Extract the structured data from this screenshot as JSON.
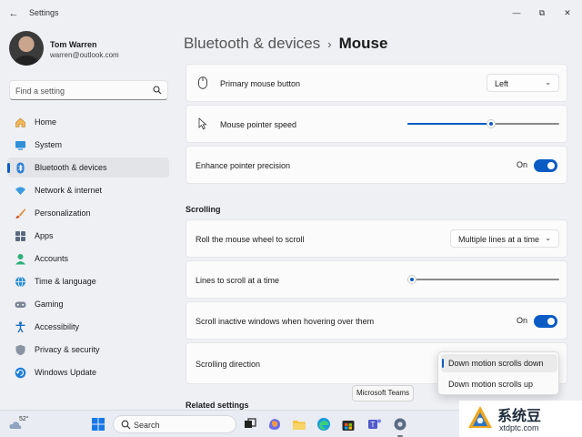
{
  "window": {
    "title": "Settings",
    "back_glyph": "←",
    "minimize_glyph": "—",
    "maximize_glyph": "⧉",
    "close_glyph": "✕"
  },
  "user": {
    "name": "Tom Warren",
    "email": "warren@outlook.com"
  },
  "search": {
    "placeholder": "Find a setting",
    "icon": "search-icon"
  },
  "sidebar": {
    "items": [
      {
        "label": "Home",
        "icon": "home-icon",
        "active": false
      },
      {
        "label": "System",
        "icon": "system-icon",
        "active": false
      },
      {
        "label": "Bluetooth & devices",
        "icon": "bluetooth-icon",
        "active": true
      },
      {
        "label": "Network & internet",
        "icon": "wifi-icon",
        "active": false
      },
      {
        "label": "Personalization",
        "icon": "brush-icon",
        "active": false
      },
      {
        "label": "Apps",
        "icon": "apps-icon",
        "active": false
      },
      {
        "label": "Accounts",
        "icon": "accounts-icon",
        "active": false
      },
      {
        "label": "Time & language",
        "icon": "globe-icon",
        "active": false
      },
      {
        "label": "Gaming",
        "icon": "gamepad-icon",
        "active": false
      },
      {
        "label": "Accessibility",
        "icon": "accessibility-icon",
        "active": false
      },
      {
        "label": "Privacy & security",
        "icon": "shield-icon",
        "active": false
      },
      {
        "label": "Windows Update",
        "icon": "update-icon",
        "active": false
      }
    ]
  },
  "breadcrumb": {
    "parent": "Bluetooth & devices",
    "separator": "›",
    "current": "Mouse"
  },
  "settings": {
    "primary_button": {
      "label": "Primary mouse button",
      "value": "Left",
      "icon": "mouse-icon"
    },
    "pointer_speed": {
      "label": "Mouse pointer speed",
      "level": 0.55,
      "icon": "pointer-icon"
    },
    "precision": {
      "label": "Enhance pointer precision",
      "state": "On",
      "on": true
    },
    "scrolling_header": "Scrolling",
    "roll_wheel": {
      "label": "Roll the mouse wheel to scroll",
      "value": "Multiple lines at a time"
    },
    "lines_to_scroll": {
      "label": "Lines to scroll at a time",
      "level": 0.03
    },
    "scroll_inactive": {
      "label": "Scroll inactive windows when hovering over them",
      "state": "On",
      "on": true
    },
    "scroll_direction": {
      "label": "Scrolling direction"
    },
    "related_header": "Related settings"
  },
  "direction_dropdown": {
    "options": [
      "Down motion scrolls down",
      "Down motion scrolls up"
    ],
    "selected": "Down motion scrolls down"
  },
  "tooltip": "Microsoft Teams",
  "taskbar": {
    "weather_temp": "52°",
    "search_label": "Search",
    "apps": [
      "windows-start-icon",
      "task-view-icon",
      "copilot-icon",
      "file-explorer-icon",
      "edge-icon",
      "store-icon",
      "teams-icon",
      "settings-icon"
    ]
  },
  "watermark": {
    "name": "系统豆",
    "url": "xtdptc.com"
  },
  "colors": {
    "accent": "#0a5bc4",
    "background": "#eef0f4",
    "card": "#fbfbfc"
  }
}
